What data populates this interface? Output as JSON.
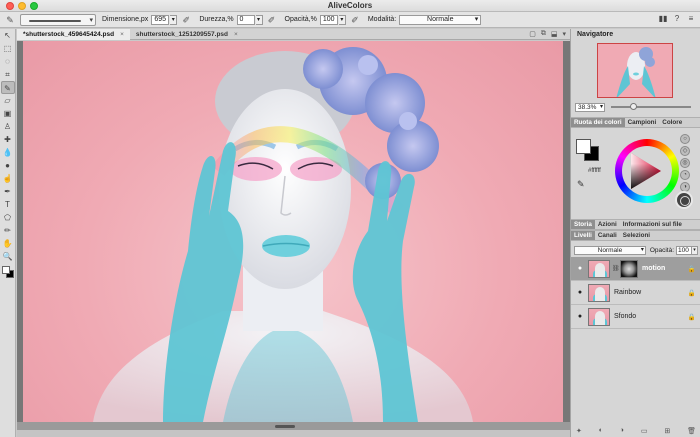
{
  "window": {
    "title": "AliveColors"
  },
  "options_bar": {
    "size_label": "Dimensione,px",
    "size_value": "695",
    "hardness_label": "Durezza,%",
    "hardness_value": "0",
    "opacity_label": "Opacità,%",
    "opacity_value": "100",
    "mode_label": "Modalità:",
    "mode_value": "Normale"
  },
  "tabs": [
    {
      "label": "*shutterstock_459645424.psd",
      "active": true
    },
    {
      "label": "shutterstock_1251209557.psd",
      "active": false
    }
  ],
  "tab_close": "×",
  "navigator": {
    "title": "Navigatore",
    "zoom": "38.3%",
    "zoom_level": 0.28
  },
  "color_tabs": [
    "Ruota dei colori",
    "Campioni",
    "Colore"
  ],
  "color": {
    "hex": "#ffffff",
    "foreground": "#ffffff",
    "background": "#000000"
  },
  "history_tabs": [
    "Storia",
    "Azioni",
    "Informazioni sul file"
  ],
  "layer_tabs": [
    "Livelli",
    "Canali",
    "Selezioni"
  ],
  "layers_panel": {
    "blend_mode": "Normale",
    "opacity_label": "Opacità:",
    "opacity_value": "100"
  },
  "layers": [
    {
      "name": "motion",
      "selected": true,
      "has_mask": true
    },
    {
      "name": "Rainbow",
      "selected": false,
      "has_mask": false
    },
    {
      "name": "Sfondo",
      "selected": false,
      "has_mask": false
    }
  ],
  "colors": {
    "canvas_bg": "#f0aab4",
    "skin": "#eef0f4",
    "cyan_paint": "#5ec5d4",
    "hair_blue": "#8fa4d8"
  }
}
